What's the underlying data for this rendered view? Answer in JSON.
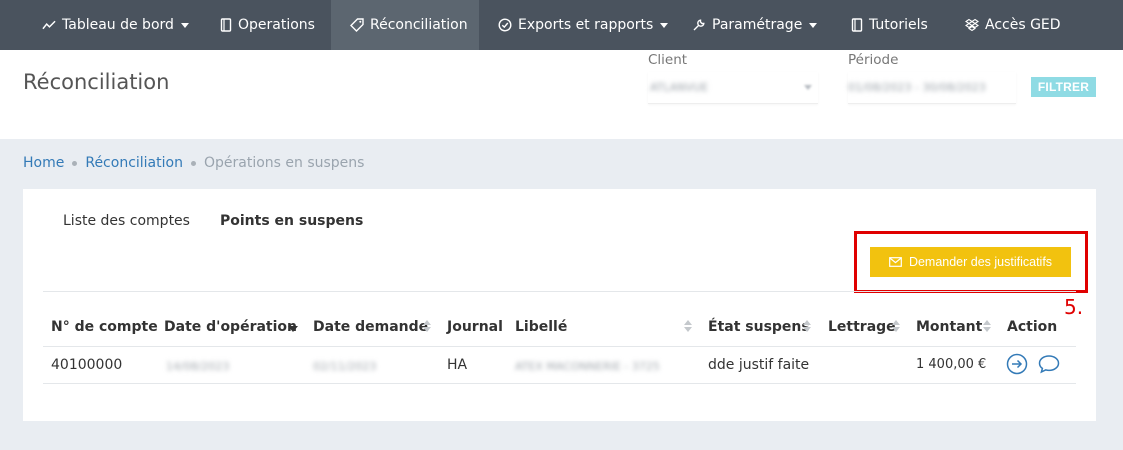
{
  "nav": {
    "items": [
      {
        "label": "Tableau de bord",
        "icon": "chart-line-icon",
        "dropdown": true,
        "active": false
      },
      {
        "label": "Operations",
        "icon": "book-icon",
        "dropdown": false,
        "active": false
      },
      {
        "label": "Réconciliation",
        "icon": "tag-icon",
        "dropdown": false,
        "active": true
      },
      {
        "label": "Exports et rapports",
        "icon": "check-circle-icon",
        "dropdown": true,
        "active": false
      },
      {
        "label": "Paramétrage",
        "icon": "wrench-icon",
        "dropdown": true,
        "active": false
      },
      {
        "label": "Tutoriels",
        "icon": "book-icon",
        "dropdown": false,
        "active": false
      },
      {
        "label": "Accès GED",
        "icon": "dropbox-icon",
        "dropdown": false,
        "active": false
      }
    ]
  },
  "header": {
    "title": "Réconciliation",
    "client_label": "Client",
    "client_value": "ATLANVUE",
    "periode_label": "Période",
    "periode_value": "01/08/2023 - 30/08/2023",
    "filter_button": "FILTRER"
  },
  "breadcrumb": {
    "home": "Home",
    "reconciliation": "Réconciliation",
    "current": "Opérations en suspens"
  },
  "tabs": {
    "liste": "Liste des comptes",
    "points": "Points en suspens"
  },
  "actions": {
    "demander_label": "Demander des justificatifs",
    "step_label": "5."
  },
  "table": {
    "headers": {
      "compte": "N° de compte",
      "date_operation": "Date d'opération",
      "date_demande": "Date demande",
      "journal": "Journal",
      "libelle": "Libellé",
      "etat": "État suspens",
      "lettrage": "Lettrage",
      "montant": "Montant",
      "action": "Action"
    },
    "rows": [
      {
        "compte": "40100000",
        "date_operation": "14/08/2023",
        "date_demande": "02/11/2023",
        "journal": "HA",
        "libelle": "ATEX MACONNERIE - 3725",
        "etat": "dde justif faite",
        "lettrage": "",
        "montant": "1 400,00 €"
      }
    ]
  },
  "colors": {
    "nav_bg": "#4a535e",
    "nav_active": "#5c6670",
    "accent_blue": "#337ab7",
    "filter_btn": "#8fdbe4",
    "demander_btn": "#f2c20f",
    "highlight_red": "#e00000"
  }
}
